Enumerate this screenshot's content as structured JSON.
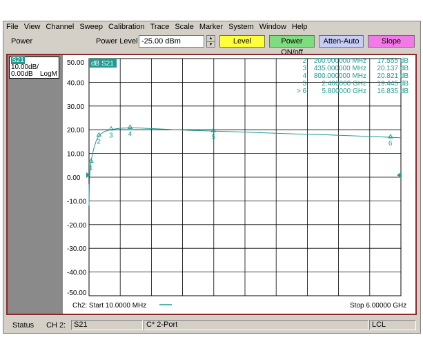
{
  "menu": [
    "File",
    "View",
    "Channel",
    "Sweep",
    "Calibration",
    "Trace",
    "Scale",
    "Marker",
    "System",
    "Window",
    "Help"
  ],
  "toolbar": {
    "title": "Power",
    "power_level_label": "Power Level",
    "power_level_value": "-25.00 dBm",
    "softkeys": [
      "Level",
      "Power ON/off",
      "Atten-Auto",
      "Slope"
    ],
    "softkey_colors": [
      "#ffff3a",
      "#7fdc7f",
      "#c8cdf6",
      "#f17ae6"
    ]
  },
  "trace_info": {
    "name": "S21",
    "scale": "10.00dB/",
    "ref": "0.00dB",
    "format": "LogM"
  },
  "plot": {
    "trace_label": "dB S21",
    "trace_color": "#1f9b8f",
    "channel_start": "Ch2: Start  10.0000 MHz",
    "stop": "Stop  6.00000 GHz"
  },
  "markers": [
    {
      "label": "2:",
      "freq": "200.000000 MHz",
      "value": "17.555 dB"
    },
    {
      "label": "3:",
      "freq": "435.000000 MHz",
      "value": "20.137 dB"
    },
    {
      "label": "4:",
      "freq": "800.000000 MHz",
      "value": "20.821 dB"
    },
    {
      "label": "5:",
      "freq": "2.400000 GHz",
      "value": "19.445 dB"
    },
    {
      "label": "> 6:",
      "freq": "5.800000 GHz",
      "value": "16.835 dB"
    }
  ],
  "status": {
    "status_label": "Status",
    "channel": "CH 2:",
    "trace": "S21",
    "cal": "C* 2-Port",
    "remote": "LCL"
  },
  "chart_data": {
    "type": "line",
    "xlim": [
      0.01,
      6.0
    ],
    "ylim": [
      -50,
      50
    ],
    "y_ticks": [
      "50.00",
      "40.00",
      "30.00",
      "20.00",
      "10.00",
      "0.00",
      "-10.00",
      "-20.00",
      "-30.00",
      "-40.00",
      "-50.00"
    ],
    "ylabel": "dB S21",
    "grid": true,
    "series": [
      {
        "name": "S21",
        "x": [
          0.01,
          0.02,
          0.04,
          0.06,
          0.1,
          0.15,
          0.2,
          0.3,
          0.435,
          0.6,
          0.8,
          1.0,
          1.5,
          2.0,
          2.4,
          3.0,
          3.5,
          4.0,
          4.5,
          5.0,
          5.5,
          5.8,
          6.0
        ],
        "y": [
          -12,
          0,
          5,
          8,
          12,
          15.5,
          17.555,
          19.2,
          20.137,
          20.6,
          20.821,
          20.7,
          20.2,
          19.7,
          19.445,
          19.0,
          18.6,
          18.2,
          17.9,
          17.5,
          17.1,
          16.835,
          16.6
        ]
      }
    ],
    "marker_points": [
      {
        "id": "1",
        "x": 0.05,
        "y": 6.5
      },
      {
        "id": "2",
        "x": 0.2,
        "y": 17.555
      },
      {
        "id": "3",
        "x": 0.435,
        "y": 20.137
      },
      {
        "id": "4",
        "x": 0.8,
        "y": 20.821
      },
      {
        "id": "5",
        "x": 2.4,
        "y": 19.445
      },
      {
        "id": "6",
        "x": 5.8,
        "y": 16.835
      }
    ]
  }
}
